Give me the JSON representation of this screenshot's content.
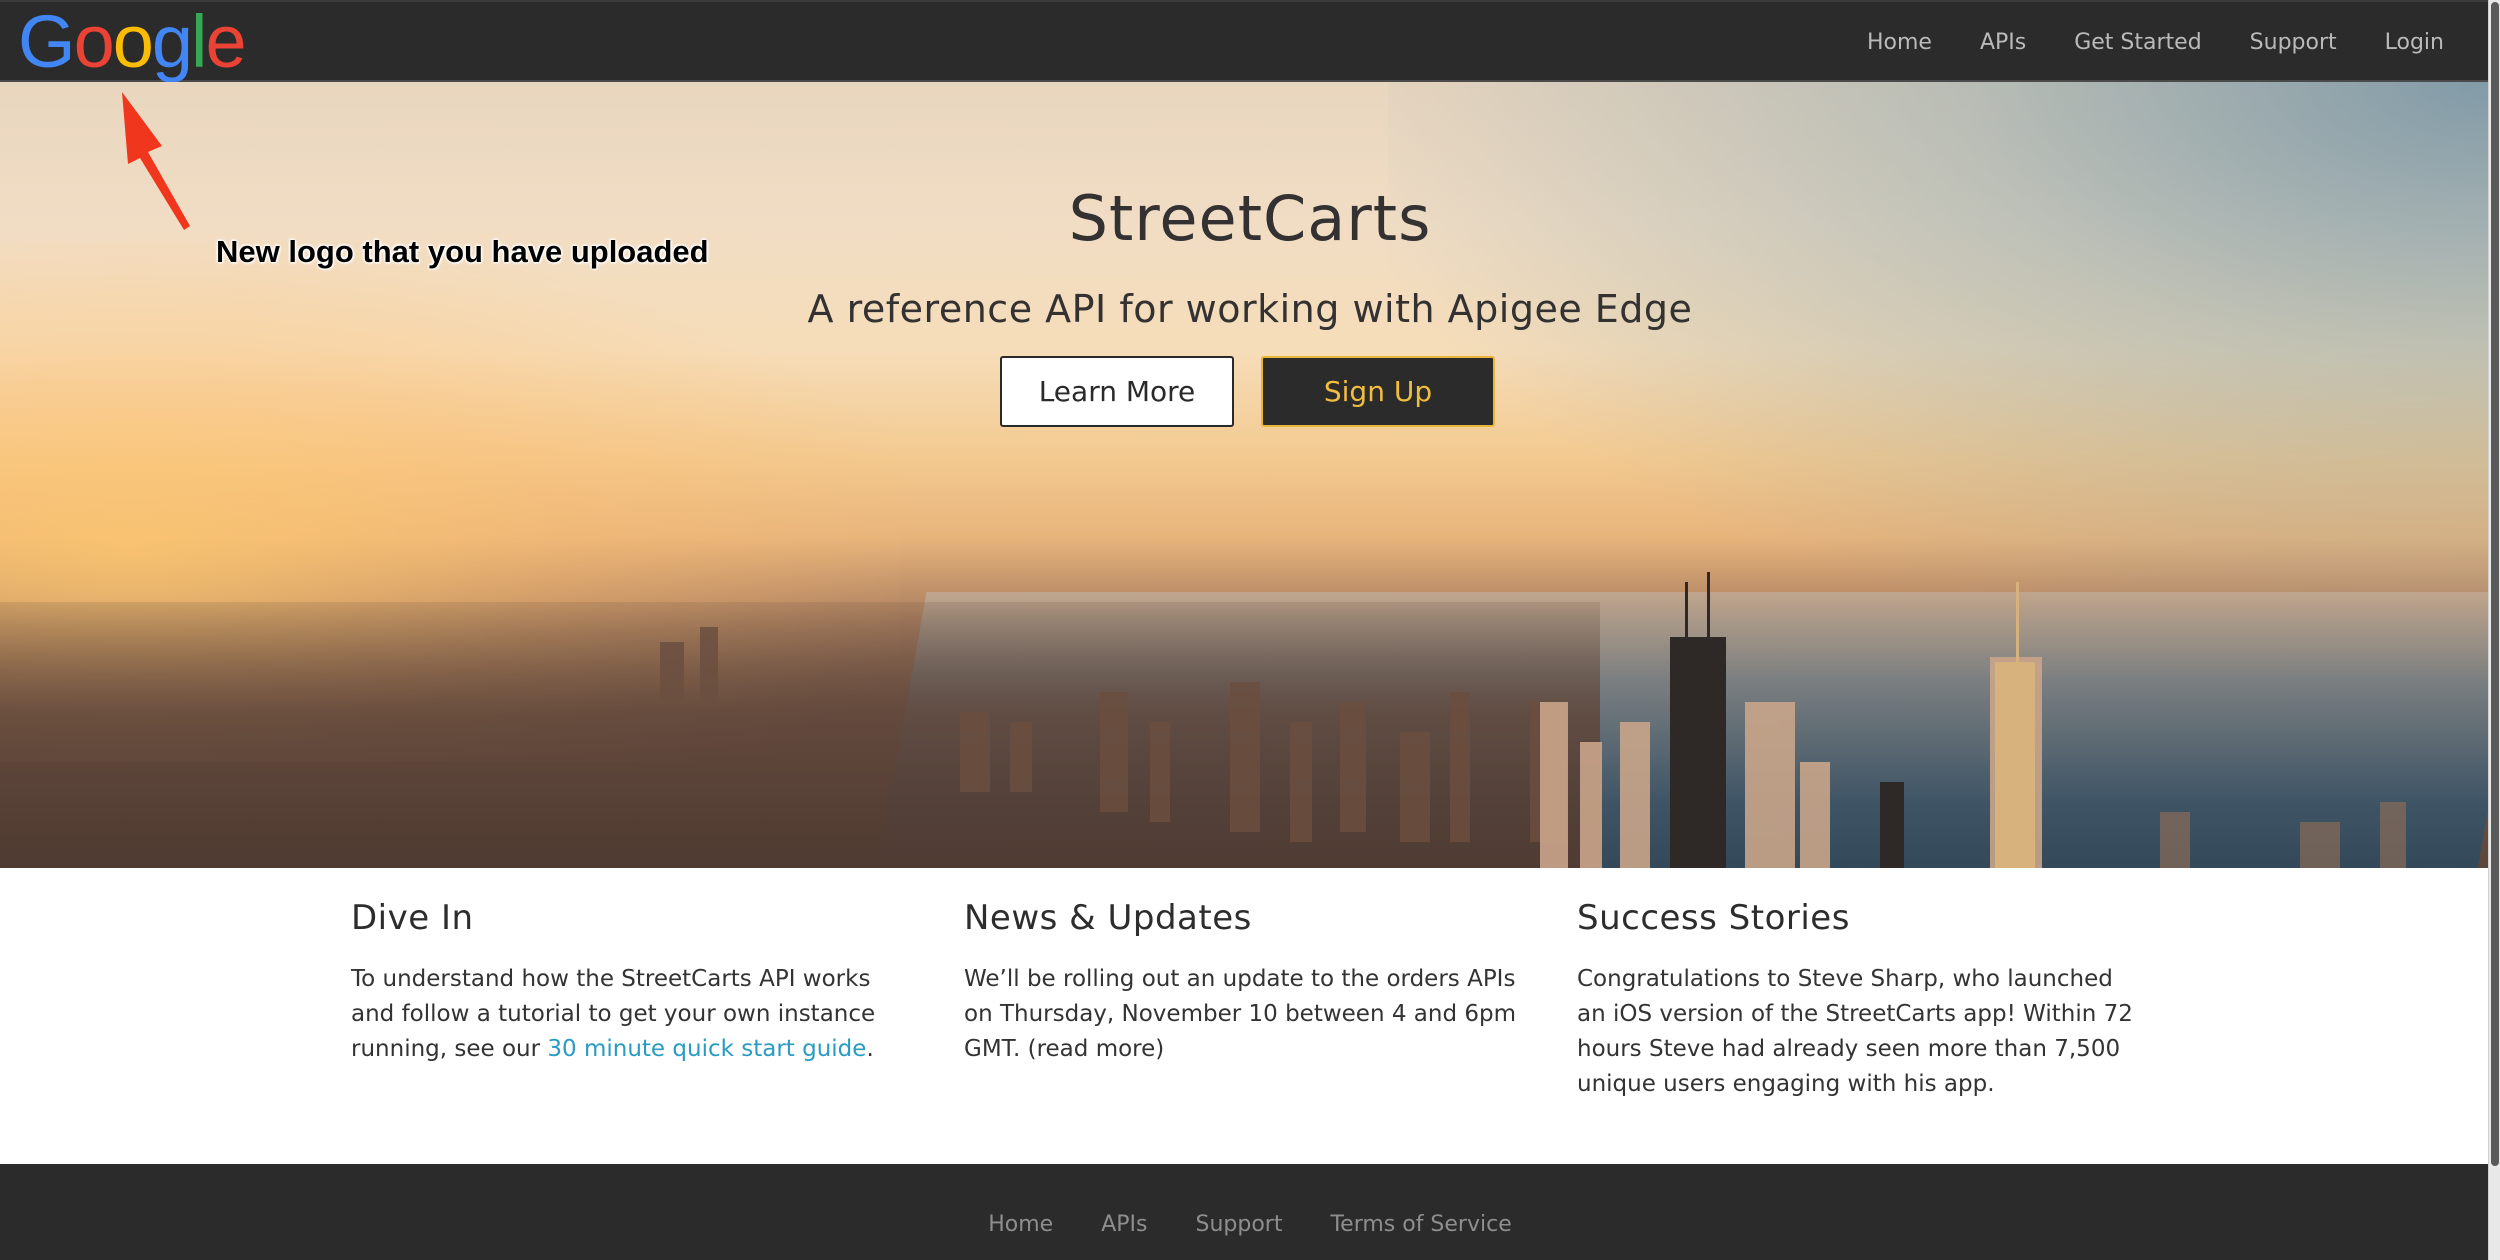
{
  "navbar": {
    "logo_letters": [
      "G",
      "o",
      "o",
      "g",
      "l",
      "e"
    ],
    "links": [
      "Home",
      "APIs",
      "Get Started",
      "Support",
      "Login"
    ]
  },
  "hero": {
    "title": "StreetCarts",
    "subtitle": "A reference API for working with Apigee Edge",
    "learn_more_label": "Learn More",
    "sign_up_label": "Sign Up"
  },
  "annotation": {
    "text": "New logo that you have uploaded",
    "arrow_color": "#f0361c"
  },
  "columns": [
    {
      "title": "Dive In",
      "text_before": "To understand how the StreetCarts API works and follow a tutorial to get your own instance running, see our ",
      "link": "30 minute quick start guide",
      "text_after": "."
    },
    {
      "title": "News & Updates",
      "text": "We’ll be rolling out an update to the orders APIs on Thursday, November 10 between 4 and 6pm GMT. (read more)"
    },
    {
      "title": "Success Stories",
      "text": "Congratulations to Steve Sharp, who launched an iOS version of the StreetCarts app! Within 72 hours Steve had already seen more than 7,500 unique users engaging with his app."
    }
  ],
  "footer": {
    "links": [
      "Home",
      "APIs",
      "Support",
      "Terms of Service"
    ]
  },
  "colors": {
    "navbar_bg": "#2a2b2a",
    "accent_yellow": "#f1bd3e",
    "link_blue": "#2a9bc3"
  }
}
